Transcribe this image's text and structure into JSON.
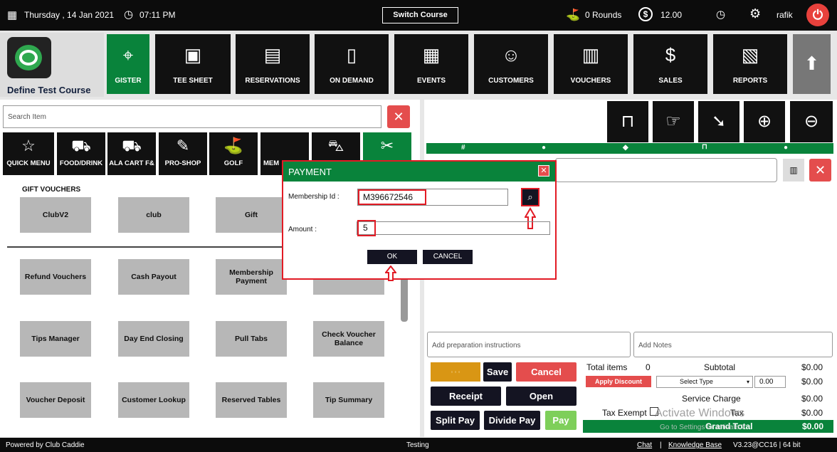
{
  "topbar": {
    "date": "Thursday , 14 Jan 2021",
    "time": "07:11 PM",
    "switch_course": "Switch Course",
    "rounds": "0 Rounds",
    "balance": "12.00",
    "user": "rafik"
  },
  "brand": {
    "course_name": "Define Test Course"
  },
  "nav": [
    {
      "label": "GISTER",
      "icon": "scanner-icon"
    },
    {
      "label": "TEE SHEET",
      "icon": "tee-sheet-icon"
    },
    {
      "label": "RESERVATIONS",
      "icon": "calendar-icon"
    },
    {
      "label": "ON DEMAND",
      "icon": "mobile-icon"
    },
    {
      "label": "EVENTS",
      "icon": "events-icon"
    },
    {
      "label": "CUSTOMERS",
      "icon": "customers-icon"
    },
    {
      "label": "VOUCHERS",
      "icon": "voucher-icon"
    },
    {
      "label": "SALES",
      "icon": "sales-icon"
    },
    {
      "label": "REPORTS",
      "icon": "reports-icon"
    }
  ],
  "search": {
    "placeholder": "Search Item"
  },
  "categories": [
    {
      "label": "QUICK MENU"
    },
    {
      "label": "FOOD/DRINK"
    },
    {
      "label": "ALA CART F&"
    },
    {
      "label": "PRO-SHOP"
    },
    {
      "label": "GOLF"
    },
    {
      "label": "MEM"
    }
  ],
  "gift_section": {
    "title": "GIFT VOUCHERS",
    "items": [
      "ClubV2",
      "club",
      "Gift"
    ]
  },
  "functions": {
    "row1": [
      "Refund Vouchers",
      "Cash Payout",
      "Membership Payment",
      ""
    ],
    "row2": [
      "Tips Manager",
      "Day End Closing",
      "Pull Tabs",
      "Check Voucher Balance"
    ],
    "row3": [
      "Voucher Deposit",
      "Customer Lookup",
      "Reserved Tables",
      "Tip Summary"
    ]
  },
  "cart": {
    "columns": [
      "#",
      "",
      "",
      "",
      ""
    ],
    "prep_placeholder": "Add preparation instructions",
    "notes_placeholder": "Add Notes"
  },
  "actions": {
    "save": "Save",
    "cancel": "Cancel",
    "receipt": "Receipt",
    "open": "Open",
    "split_pay": "Split Pay",
    "divide_pay": "Divide Pay",
    "pay": "Pay"
  },
  "totals": {
    "total_items_label": "Total items",
    "total_items_value": "0",
    "subtotal_label": "Subtotal",
    "subtotal_value": "$0.00",
    "apply_discount": "Apply Discount",
    "discount_type": "Select Type",
    "discount_amount": "0.00",
    "discount_value": "$0.00",
    "service_charge_label": "Service Charge",
    "service_charge_value": "$0.00",
    "tax_exempt_label": "Tax Exempt",
    "tax_label": "Tax",
    "tax_value": "$0.00",
    "grand_total_label": "Grand Total",
    "grand_total_value": "$0.00"
  },
  "watermark": {
    "line1": "Activate Windows",
    "line2": "Go to Settings to activate Windows."
  },
  "modal": {
    "title": "PAYMENT",
    "membership_label": "Membership Id :",
    "membership_value": "M396672546",
    "amount_label": "Amount :",
    "amount_value": "5",
    "ok": "OK",
    "cancel": "CANCEL"
  },
  "footer": {
    "powered_by": "Powered by Club Caddie",
    "center": "Testing",
    "chat": "Chat",
    "separator": "|",
    "knowledge": "Knowledge Base",
    "version": "V3.23@CC16 | 64 bit"
  },
  "colors": {
    "green": "#09833b",
    "red": "#e44d4d",
    "dark": "#111111",
    "highlight": "#e21b25"
  }
}
